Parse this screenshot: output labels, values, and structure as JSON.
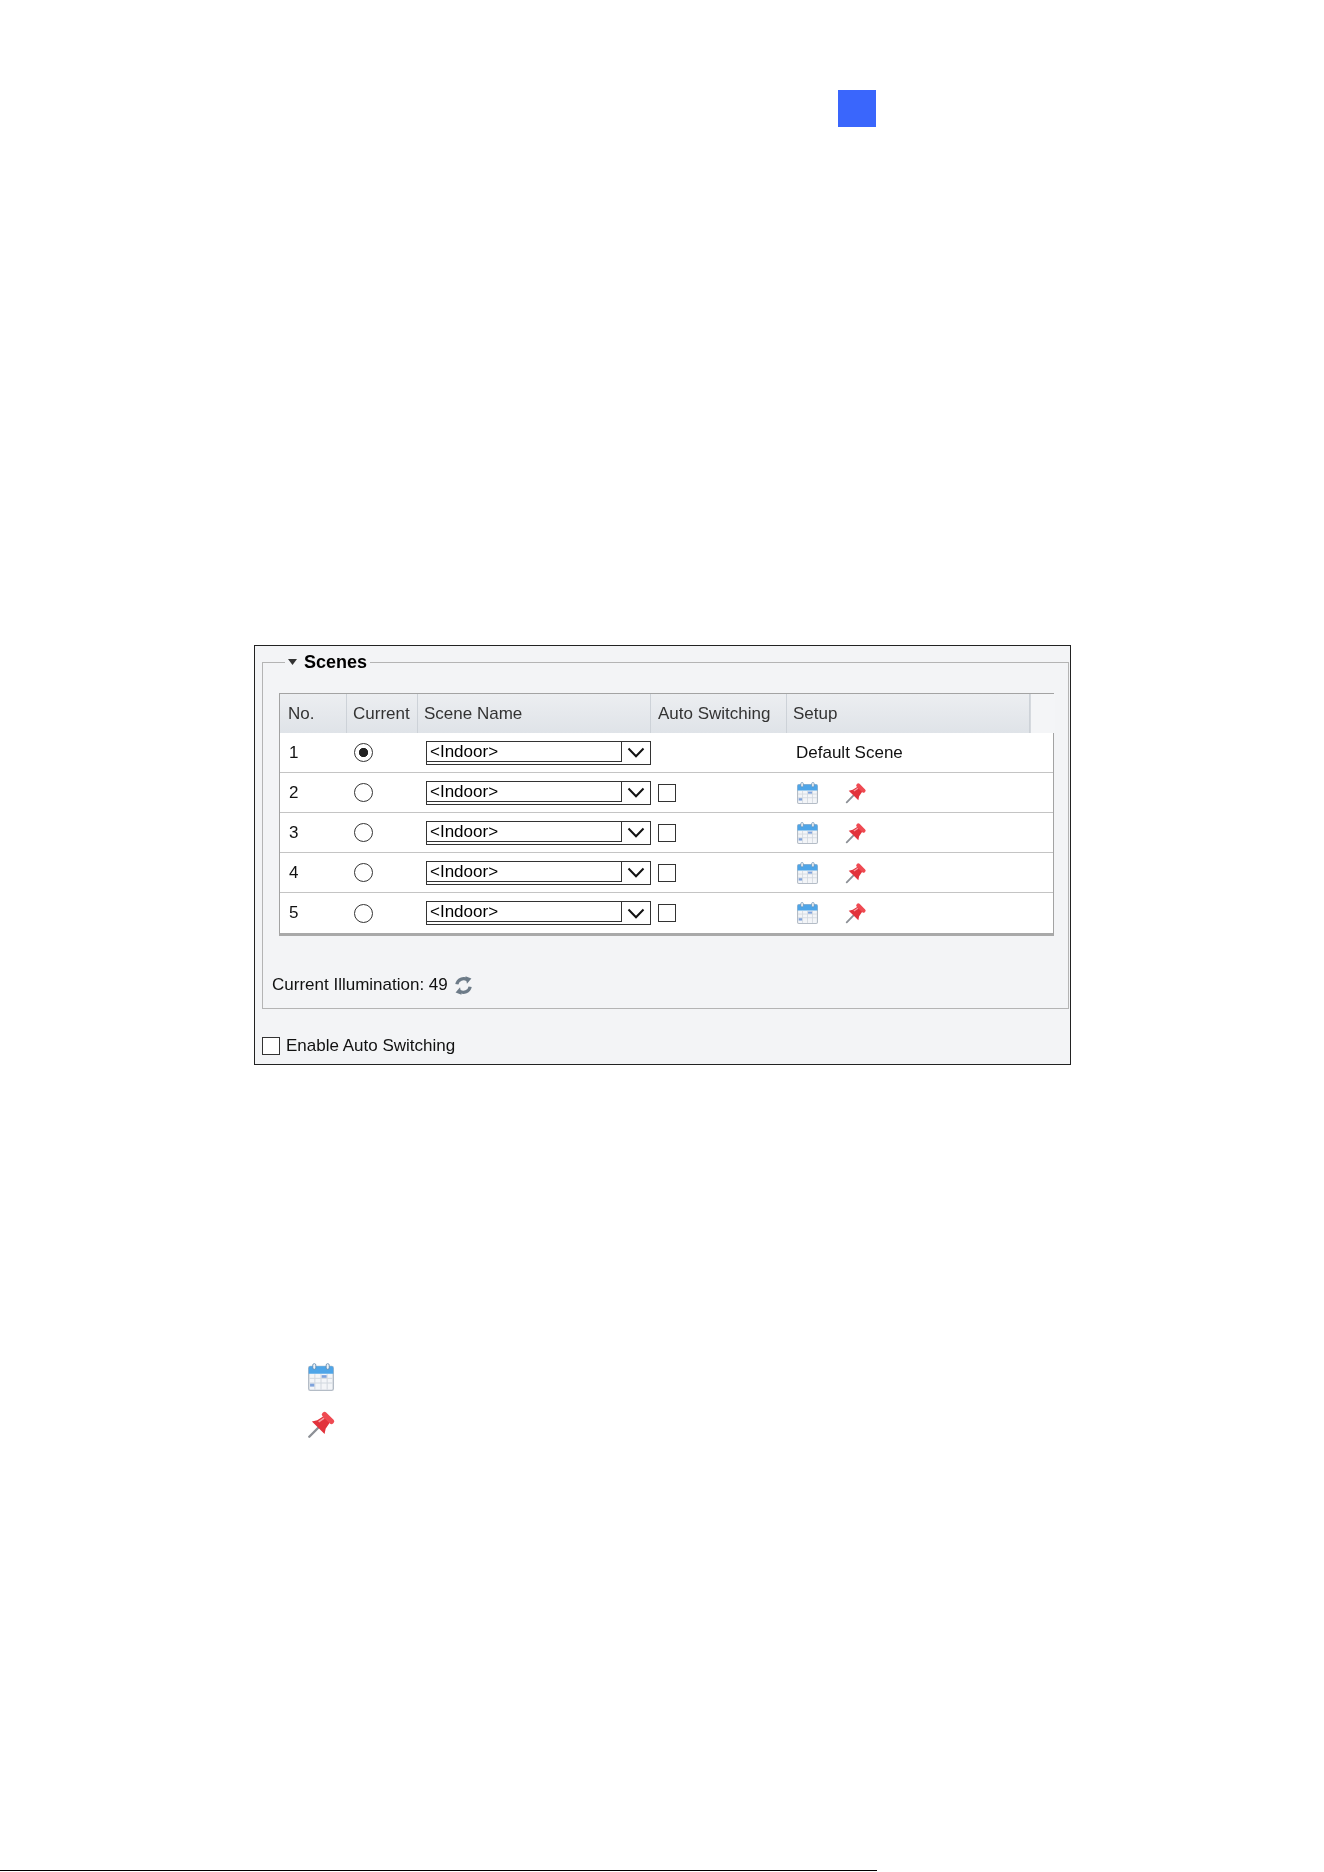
{
  "panel": {
    "title": "Scenes",
    "expanded": true,
    "table": {
      "columns": [
        "No.",
        "Current",
        "Scene Name",
        "Auto Switching",
        "Setup"
      ],
      "rows": [
        {
          "kind": "default",
          "no": "1",
          "selected": true,
          "scene_name": "<Indoor>",
          "setup": "Default Scene"
        },
        {
          "kind": "custom",
          "no": "2",
          "selected": false,
          "scene_name": "<Indoor>",
          "checked": false
        },
        {
          "kind": "custom",
          "no": "3",
          "selected": false,
          "scene_name": "<Indoor>",
          "checked": false
        },
        {
          "kind": "custom",
          "no": "4",
          "selected": false,
          "scene_name": "<Indoor>",
          "checked": false
        },
        {
          "kind": "custom",
          "no": "5",
          "selected": false,
          "scene_name": "<Indoor>",
          "checked": false
        }
      ]
    },
    "illumination": "Current Illumination: 49",
    "enable_auto_switching": {
      "label": "Enable Auto Switching",
      "checked": false
    }
  }
}
